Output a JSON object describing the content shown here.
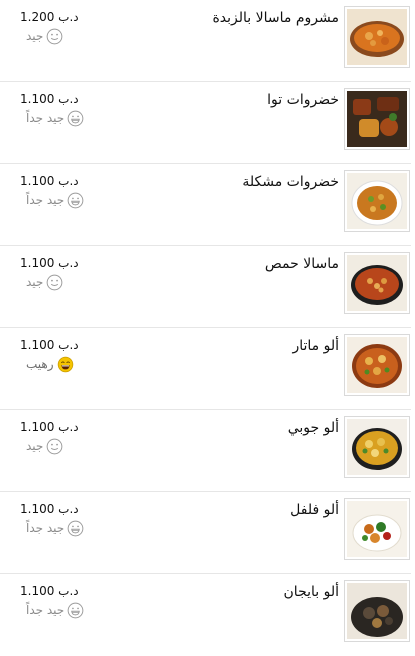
{
  "menu": {
    "items": [
      {
        "name": "مشروم ماسالا بالزبدة",
        "price": "د.ب 1.200",
        "rating": "جيد",
        "rating_icon": "smile-face-icon",
        "image": "mushroom-masala-photo"
      },
      {
        "name": "خضروات توا",
        "price": "د.ب 1.100",
        "rating": "جيد جداً",
        "rating_icon": "grin-face-icon",
        "image": "vegetable-tawa-photo"
      },
      {
        "name": "خضروات مشكلة",
        "price": "د.ب 1.100",
        "rating": "جيد جداً",
        "rating_icon": "grin-face-icon",
        "image": "mixed-vegetables-photo"
      },
      {
        "name": "ماسالا حمص",
        "price": "د.ب 1.100",
        "rating": "جيد",
        "rating_icon": "smile-face-icon",
        "image": "chana-masala-photo"
      },
      {
        "name": "ألو ماتار",
        "price": "د.ب 1.100",
        "rating": "رهيب",
        "rating_icon": "laughing-face-icon",
        "image": "aloo-matar-photo"
      },
      {
        "name": "ألو جوبي",
        "price": "د.ب 1.100",
        "rating": "جيد",
        "rating_icon": "smile-face-icon",
        "image": "aloo-gobi-photo"
      },
      {
        "name": "ألو فلفل",
        "price": "د.ب 1.100",
        "rating": "جيد جداً",
        "rating_icon": "grin-face-icon",
        "image": "aloo-capsicum-photo"
      },
      {
        "name": "ألو بايجان",
        "price": "د.ب 1.100",
        "rating": "جيد جداً",
        "rating_icon": "grin-face-icon",
        "image": "aloo-baingan-photo"
      }
    ]
  },
  "colors": {
    "divider": "#e6e6e6",
    "face_outline": "#9a9a9a",
    "laugh_face_fill": "#f5c400"
  }
}
